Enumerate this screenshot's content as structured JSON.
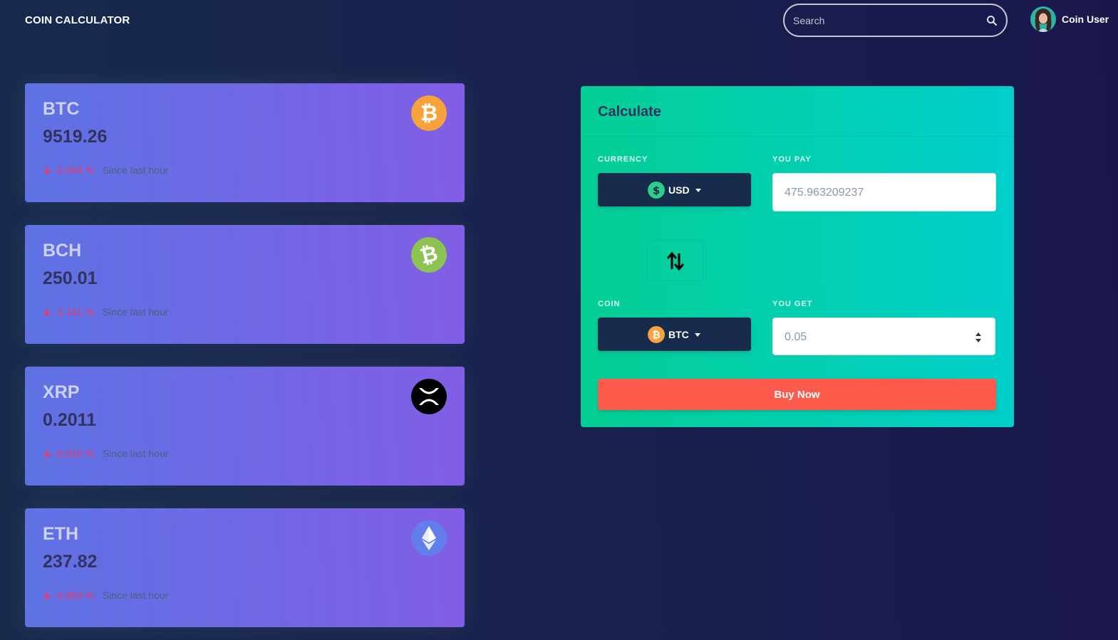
{
  "navbar": {
    "brand": "COIN CALCULATOR",
    "search_placeholder": "Search",
    "user_name": "Coin User"
  },
  "cards": [
    {
      "symbol": "BTC",
      "price": "9519.26",
      "change": "-0.544 %",
      "since": "Since last hour",
      "icon": "bitcoin-icon",
      "icon_color": "#f7a23b"
    },
    {
      "symbol": "BCH",
      "price": "250.01",
      "change": "-1.141 %",
      "since": "Since last hour",
      "icon": "bitcoin-cash-icon",
      "icon_color": "#8dc351"
    },
    {
      "symbol": "XRP",
      "price": "0.2011",
      "change": "-0.518 %",
      "since": "Since last hour",
      "icon": "xrp-icon",
      "icon_color": "#000000"
    },
    {
      "symbol": "ETH",
      "price": "237.82",
      "change": "-0.803 %",
      "since": "Since last hour",
      "icon": "ethereum-icon",
      "icon_color": "#627eea"
    }
  ],
  "calculator": {
    "title": "Calculate",
    "currency_label": "CURRENCY",
    "currency_value": "USD",
    "you_pay_label": "YOU PAY",
    "you_pay_value": "475.963209237",
    "coin_label": "COIN",
    "coin_value": "BTC",
    "you_get_label": "YOU GET",
    "you_get_value": "0.05",
    "buy_label": "Buy Now"
  },
  "colors": {
    "background": "#172b4d",
    "card_gradient_start": "#5e72e4",
    "card_gradient_end": "#825ee4",
    "negative": "#f5365c",
    "calc_gradient_start": "#04cf93",
    "calc_gradient_end": "#00cfcc",
    "buy_button": "#ff5b4c",
    "dropdown": "#172b4d"
  }
}
